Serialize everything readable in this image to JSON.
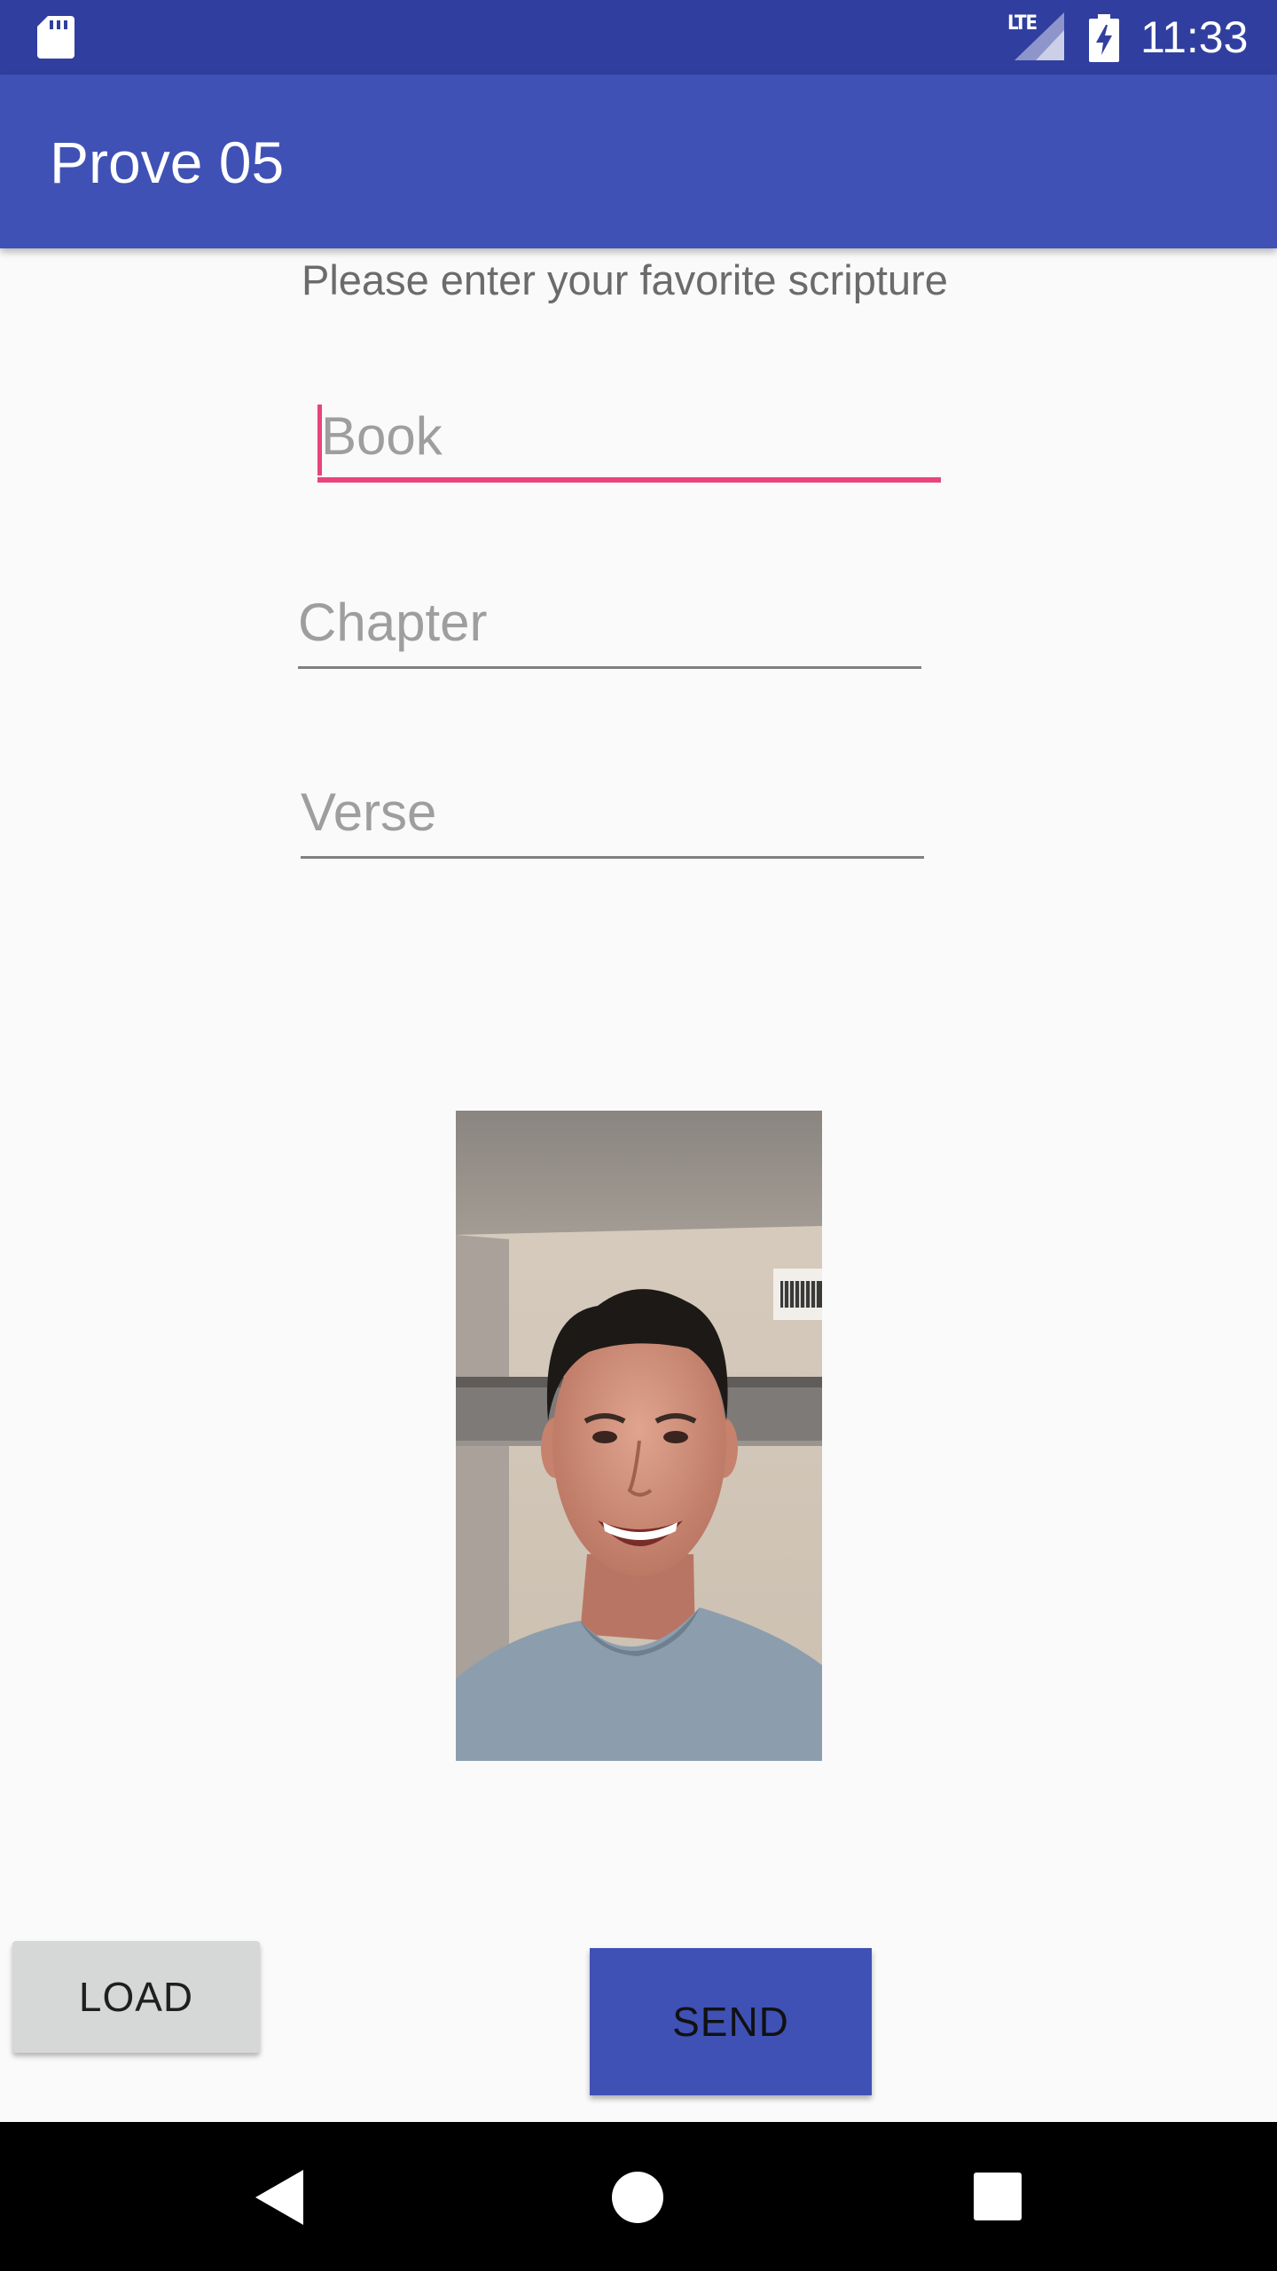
{
  "status_bar": {
    "time": "11:33",
    "network_label": "LTE",
    "icons": [
      "sd-card-icon",
      "lte-signal-icon",
      "battery-charging-icon"
    ]
  },
  "app_bar": {
    "title": "Prove 05"
  },
  "form": {
    "prompt": "Please enter your favorite scripture",
    "book": {
      "placeholder": "Book",
      "value": ""
    },
    "chapter": {
      "placeholder": "Chapter",
      "value": ""
    },
    "verse": {
      "placeholder": "Verse",
      "value": ""
    }
  },
  "image": {
    "description_icon": "photo-of-person"
  },
  "buttons": {
    "load_label": "LOAD",
    "send_label": "SEND"
  },
  "nav_bar": {
    "icons": [
      "back-icon",
      "home-icon",
      "recents-icon"
    ]
  },
  "colors": {
    "status_bar": "#303f9f",
    "app_bar": "#3f51b5",
    "accent": "#e8457a",
    "send_button": "#3f51b5",
    "load_button": "#d6d7d7"
  }
}
